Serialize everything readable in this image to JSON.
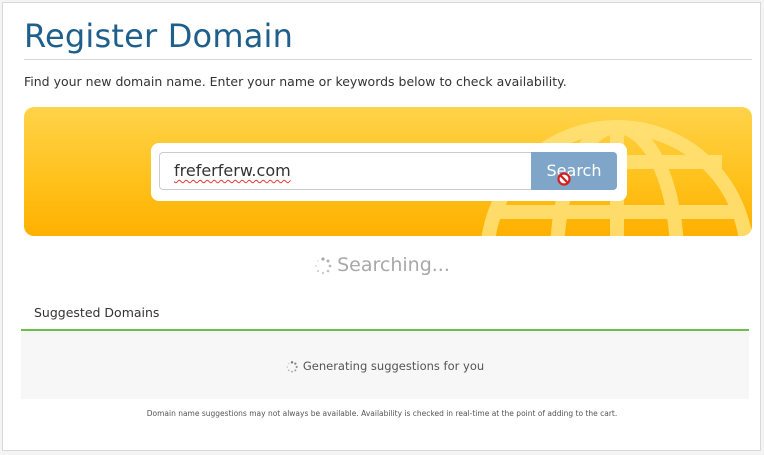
{
  "page": {
    "title": "Register Domain",
    "intro": "Find your new domain name. Enter your name or keywords below to check availability."
  },
  "search": {
    "value": "freferferw.com",
    "button_label": "Search"
  },
  "status": {
    "searching": "Searching..."
  },
  "suggestions": {
    "tab_label": "Suggested Domains",
    "loading_text": "Generating suggestions for you",
    "disclaimer": "Domain name suggestions may not always be available. Availability is checked in real-time at the point of adding to the cart."
  },
  "colors": {
    "title": "#1f5f8b",
    "banner": "#ffc21d",
    "button": "#7fa6c9",
    "tab_underline": "#6cc04a"
  }
}
